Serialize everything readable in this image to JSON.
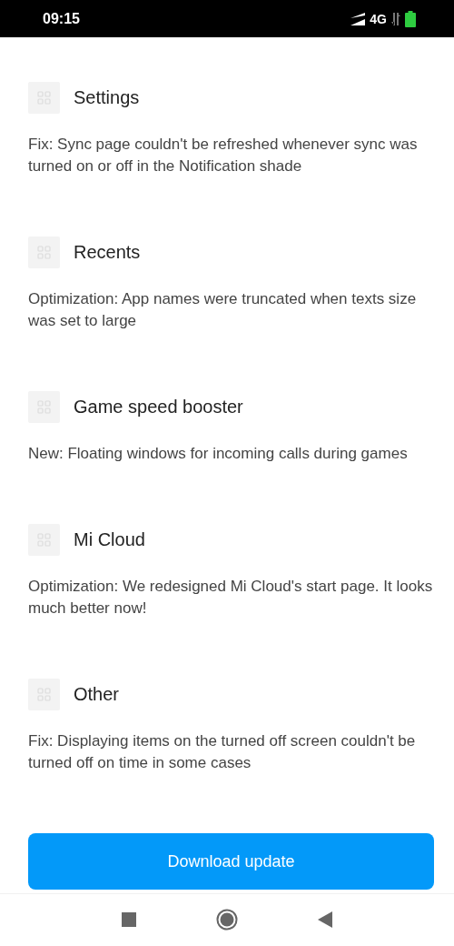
{
  "status_bar": {
    "time": "09:15",
    "network": "4G"
  },
  "sections": [
    {
      "title": "Settings",
      "description": "Fix: Sync page couldn't be refreshed whenever sync was turned on or off in the Notification shade"
    },
    {
      "title": "Recents",
      "description": "Optimization: App names were truncated when texts size was set to large"
    },
    {
      "title": "Game speed booster",
      "description": "New: Floating windows for incoming calls during games"
    },
    {
      "title": "Mi Cloud",
      "description": "Optimization: We redesigned Mi Cloud's start page. It looks much better now!"
    },
    {
      "title": "Other",
      "description": "Fix: Displaying items on the turned off screen couldn't be turned off on time in some cases"
    }
  ],
  "button": {
    "label": "Download update"
  }
}
